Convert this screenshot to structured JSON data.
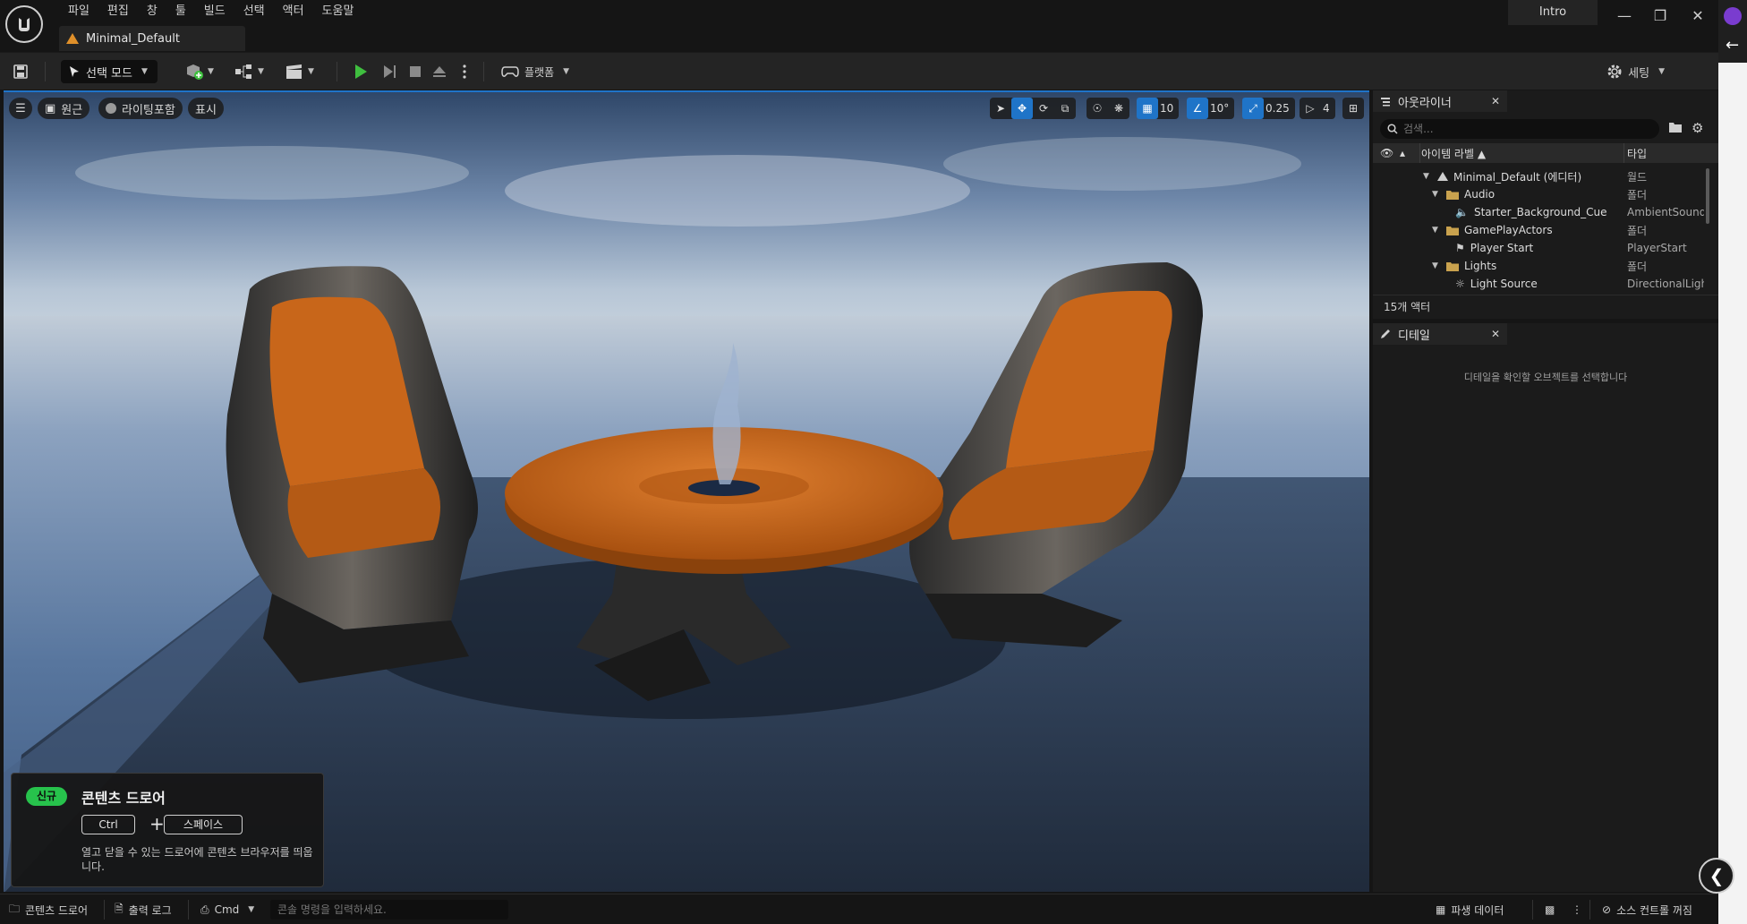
{
  "menu": [
    "파일",
    "편집",
    "창",
    "툴",
    "빌드",
    "선택",
    "액터",
    "도움말"
  ],
  "level_tab": "Minimal_Default",
  "project_name": "Intro",
  "toolbar": {
    "mode": "선택 모드",
    "platforms": "플랫폼",
    "settings": "세팅"
  },
  "viewport": {
    "perspective": "원근",
    "lighting": "라이팅포함",
    "show": "표시",
    "grid_snap": "10",
    "rotation_snap": "10°",
    "scale_snap": "0.25",
    "camera_speed": "4"
  },
  "content_drawer_notice": {
    "badge": "신규",
    "title": "콘텐츠 드로어",
    "key1": "Ctrl",
    "plus": "+",
    "key2": "스페이스",
    "body": "열고 닫을 수 있는 드로어에 콘텐츠 브라우저를 띄웁니다."
  },
  "outliner": {
    "tab": "아웃라이너",
    "search_placeholder": "검색...",
    "col_label": "아이템 라벨 ▲",
    "col_type": "타입",
    "rows": [
      {
        "name": "Minimal_Default (에디터)",
        "type": "월드"
      },
      {
        "name": "Audio",
        "type": "폴더"
      },
      {
        "name": "Starter_Background_Cue",
        "type": "AmbientSound"
      },
      {
        "name": "GamePlayActors",
        "type": "폴더"
      },
      {
        "name": "Player Start",
        "type": "PlayerStart"
      },
      {
        "name": "Lights",
        "type": "폴더"
      },
      {
        "name": "Light Source",
        "type": "DirectionalLight"
      }
    ],
    "footer": "15개 액터"
  },
  "details": {
    "tab": "디테일",
    "empty_text": "디테일을 확인할 오브젝트를 선택합니다"
  },
  "statusbar": {
    "content_drawer": "콘텐츠 드로어",
    "output_log": "출력 로그",
    "cmd": "Cmd",
    "console_placeholder": "콘솔 명령을 입력하세요.",
    "derived_data": "파생 데이터",
    "source_control": "소스 컨트롤 꺼짐"
  },
  "colors": {
    "accent": "#1f74c8",
    "badge_green": "#27c24c",
    "play_green": "#3fbf3f",
    "folder": "#c9a24e",
    "chair_orange": "#c8661a",
    "table_orange": "#cf6a1f"
  }
}
